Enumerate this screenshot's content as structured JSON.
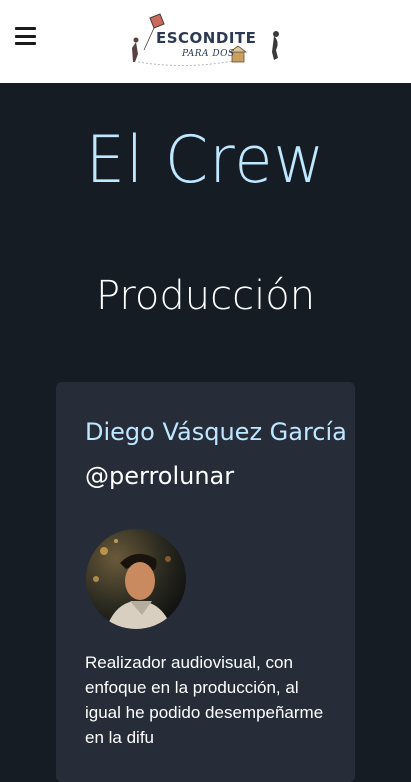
{
  "header": {
    "menu_icon": "hamburger-icon",
    "logo_title": "ESCONDITE",
    "logo_subtitle": "PARA DOS"
  },
  "page": {
    "title": "El Crew",
    "section": "Producción"
  },
  "card": {
    "name": "Diego Vásquez García",
    "handle": "@perrolunar",
    "avatar_icon": "profile-photo",
    "bio": "Realizador audiovisual, con enfoque en la producción, al igual he podido desempeñarme en la difu"
  },
  "colors": {
    "background": "#161c24",
    "card": "#262d38",
    "accent": "#bfe7ff",
    "header": "#ffffff"
  }
}
